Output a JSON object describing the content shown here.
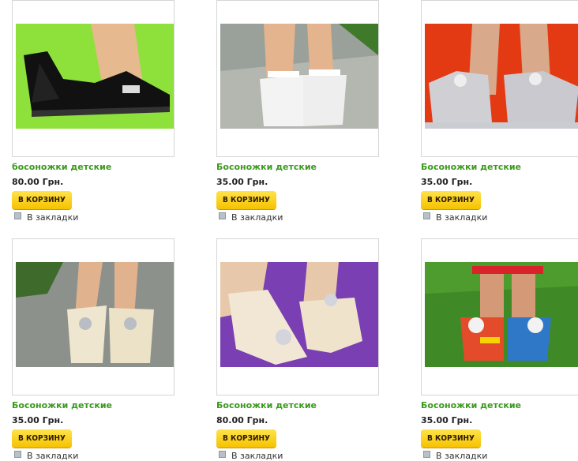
{
  "products": [
    {
      "title": "босоножки детские",
      "price": "80.00 Грн.",
      "cart_label": "В КОРЗИНУ",
      "bookmark_label": "В закладки",
      "image": "black-patent-slingback-sandals"
    },
    {
      "title": "Босоножки детские",
      "price": "35.00 Грн.",
      "cart_label": "В КОРЗИНУ",
      "bookmark_label": "В закладки",
      "image": "white-sandals-on-paving"
    },
    {
      "title": "Босоножки детские",
      "price": "35.00 Грн.",
      "cart_label": "В КОРЗИНУ",
      "bookmark_label": "В закладки",
      "image": "silver-peep-toe-shoes"
    },
    {
      "title": "Босоножки детские",
      "price": "35.00 Грн.",
      "cart_label": "В КОРЗИНУ",
      "bookmark_label": "В закладки",
      "image": "cream-bow-sandals"
    },
    {
      "title": "Босоножки детские",
      "price": "80.00 Грн.",
      "cart_label": "В КОРЗИНУ",
      "bookmark_label": "В закладки",
      "image": "cream-buckle-sandals-purple"
    },
    {
      "title": "Босоножки детские",
      "price": "35.00 Грн.",
      "cart_label": "В КОРЗИНУ",
      "bookmark_label": "В закладки",
      "image": "colorful-flower-sandals-grass"
    }
  ],
  "colors": {
    "title": "#3a9a1c",
    "cart_button": "#f6c200",
    "border": "#d6d6d6"
  }
}
